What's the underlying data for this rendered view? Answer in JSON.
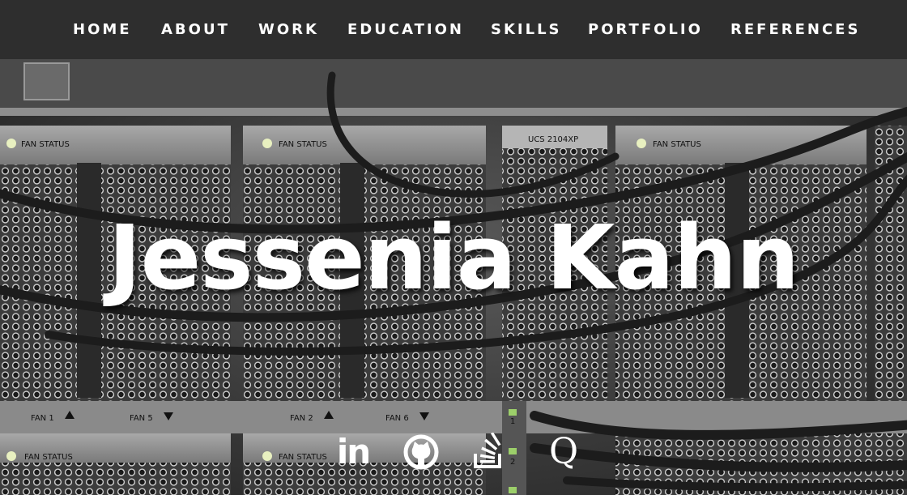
{
  "nav": {
    "items": [
      {
        "label": "HOME"
      },
      {
        "label": "ABOUT"
      },
      {
        "label": "WORK"
      },
      {
        "label": "EDUCATION"
      },
      {
        "label": "SKILLS"
      },
      {
        "label": "PORTFOLIO"
      },
      {
        "label": "REFERENCES"
      }
    ]
  },
  "hero": {
    "name": "Jessenia Kahn",
    "background": {
      "labels": {
        "fan_status": "FAN STATUS",
        "chassis": "UCS 2104XP",
        "fan1": "FAN 1",
        "fan5": "FAN 5",
        "fan2": "FAN 2",
        "fan6": "FAN 6",
        "port1": "1",
        "port2": "2"
      }
    }
  },
  "social": {
    "linkedin": {
      "icon": "linkedin-icon",
      "glyph": "in"
    },
    "github": {
      "icon": "github-icon"
    },
    "stackoverflow": {
      "icon": "stackoverflow-icon"
    },
    "quora": {
      "icon": "quora-icon",
      "glyph": "Q"
    }
  },
  "colors": {
    "nav_bg": "#2e2e2e",
    "text": "#ffffff"
  }
}
